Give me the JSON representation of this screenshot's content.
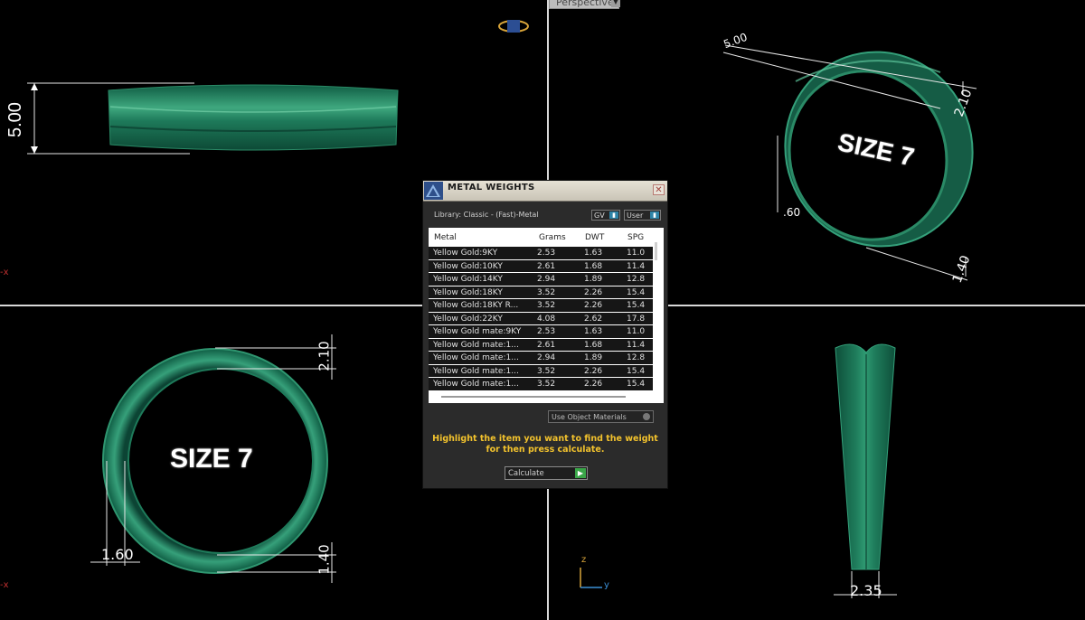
{
  "viewport_label": "Perspective",
  "axis_indicator": {
    "z": "z",
    "y": "y",
    "x_marker": "-x"
  },
  "viewports": {
    "top_left": {
      "dimension": "5.00"
    },
    "top_right": {
      "size_label": "SIZE 7",
      "dims": [
        "5.00",
        "2.10",
        ".60",
        "1.40"
      ]
    },
    "bottom_left": {
      "size_label": "SIZE 7",
      "dims": [
        "2.10",
        "1.60",
        "1.40"
      ]
    },
    "bottom_right": {
      "dimension": "2.35"
    }
  },
  "dialog": {
    "title": "METAL WEIGHTS",
    "close_icon": "close-icon",
    "library": "Library: Classic - (Fast)-Metal",
    "toggle_gv": "GV",
    "toggle_user": "User",
    "columns": [
      "Metal",
      "Grams",
      "DWT",
      "SPG"
    ],
    "rows": [
      {
        "metal": "Yellow Gold:9KY",
        "grams": "2.53",
        "dwt": "1.63",
        "spg": "11.0"
      },
      {
        "metal": "Yellow Gold:10KY",
        "grams": "2.61",
        "dwt": "1.68",
        "spg": "11.4"
      },
      {
        "metal": "Yellow Gold:14KY",
        "grams": "2.94",
        "dwt": "1.89",
        "spg": "12.8"
      },
      {
        "metal": "Yellow Gold:18KY",
        "grams": "3.52",
        "dwt": "2.26",
        "spg": "15.4"
      },
      {
        "metal": "Yellow Gold:18KY R...",
        "grams": "3.52",
        "dwt": "2.26",
        "spg": "15.4"
      },
      {
        "metal": "Yellow Gold:22KY",
        "grams": "4.08",
        "dwt": "2.62",
        "spg": "17.8"
      },
      {
        "metal": "Yellow Gold mate:9KY",
        "grams": "2.53",
        "dwt": "1.63",
        "spg": "11.0"
      },
      {
        "metal": "Yellow Gold mate:1...",
        "grams": "2.61",
        "dwt": "1.68",
        "spg": "11.4"
      },
      {
        "metal": "Yellow Gold mate:1...",
        "grams": "2.94",
        "dwt": "1.89",
        "spg": "12.8"
      },
      {
        "metal": "Yellow Gold mate:1...",
        "grams": "3.52",
        "dwt": "2.26",
        "spg": "15.4"
      },
      {
        "metal": "Yellow Gold mate:1...",
        "grams": "3.52",
        "dwt": "2.26",
        "spg": "15.4"
      }
    ],
    "material_select": "Use Object Materials",
    "hint": "Highlight the item you want to find the weight for then press calculate.",
    "calculate_label": "Calculate",
    "accent_color": "#f2c22d"
  }
}
